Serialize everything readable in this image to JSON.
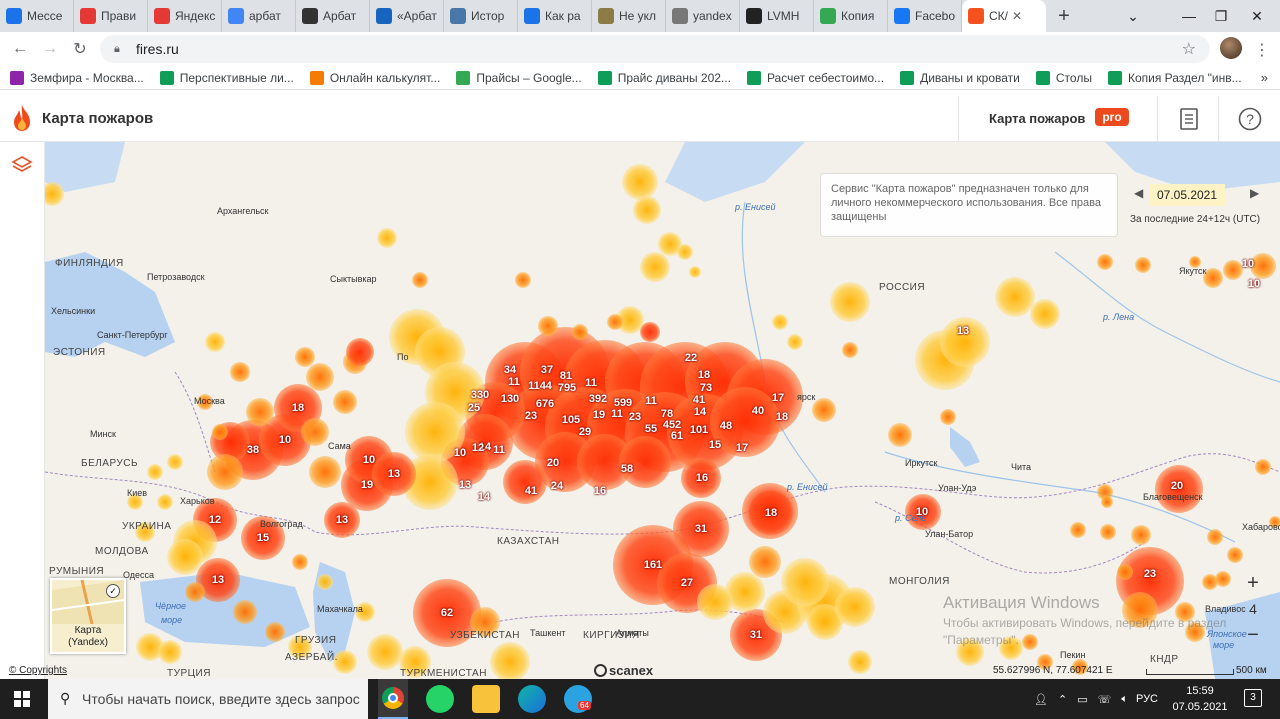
{
  "browser": {
    "tabs": [
      {
        "label": "Мессе",
        "icon": "messenger-icon",
        "color": "#1a73e8"
      },
      {
        "label": "Прави",
        "icon": "a-letter-icon",
        "color": "#e53935"
      },
      {
        "label": "Яндекс",
        "icon": "map-pin-icon",
        "color": "#e53935"
      },
      {
        "label": "арбат",
        "icon": "google-icon",
        "color": "#4285f4"
      },
      {
        "label": "Арбат",
        "icon": "wikipedia-icon",
        "color": "#333333"
      },
      {
        "label": "«Арбат",
        "icon": "news-icon",
        "color": "#1565c0"
      },
      {
        "label": "Истор",
        "icon": "vk-icon",
        "color": "#4a76a8"
      },
      {
        "label": "Как ра",
        "icon": "circle-icon",
        "color": "#1a73e8"
      },
      {
        "label": "Не укл",
        "icon": "k-letter-icon",
        "color": "#8d7b45"
      },
      {
        "label": "yandex",
        "icon": "globe-icon",
        "color": "#777777"
      },
      {
        "label": "LVMH",
        "icon": "b-letter-icon",
        "color": "#222222"
      },
      {
        "label": "Копия",
        "icon": "drive-icon",
        "color": "#34a853"
      },
      {
        "label": "Facebo",
        "icon": "facebook-icon",
        "color": "#1877f2"
      },
      {
        "label": "СК/",
        "icon": "flame-icon",
        "color": "#f4511e",
        "active": true
      }
    ],
    "url": "fires.ru",
    "bookmarks": [
      {
        "label": "Земфира - Москва...",
        "icon": "z-letter-icon",
        "color": "#8e24aa"
      },
      {
        "label": "Перспективные ли...",
        "icon": "sheets-icon",
        "color": "#0f9d58"
      },
      {
        "label": "Онлайн калькулят...",
        "icon": "p-letter-icon",
        "color": "#f57c00"
      },
      {
        "label": "Прайсы – Google...",
        "icon": "drive-icon",
        "color": "#34a853"
      },
      {
        "label": "Прайс диваны 202...",
        "icon": "sheets-icon",
        "color": "#0f9d58"
      },
      {
        "label": "Расчет себестоимо...",
        "icon": "sheets-icon",
        "color": "#0f9d58"
      },
      {
        "label": "Диваны и кровати",
        "icon": "sheets-icon",
        "color": "#0f9d58"
      },
      {
        "label": "Столы",
        "icon": "sheets-icon",
        "color": "#0f9d58"
      },
      {
        "label": "Копия Раздел \"инв...",
        "icon": "sheets-icon",
        "color": "#0f9d58"
      }
    ],
    "more_bookmarks": "»"
  },
  "app": {
    "title": "Карта пожаров",
    "pro_link": "Карта пожаров",
    "pro_badge": "pro",
    "accent": "#ec4a1c"
  },
  "info": {
    "notice": "Сервис \"Карта пожаров\" предназначен только для личного некоммерческого использования. Все права защищены",
    "date": "07.05.2021",
    "period": "За последние 24+12ч (UTC)"
  },
  "map": {
    "labels": [
      {
        "t": "Архангельск",
        "c": "city"
      },
      {
        "t": "ФИНЛЯНДИЯ",
        "c": "country"
      },
      {
        "t": "Петрозаводск",
        "c": "city"
      },
      {
        "t": "Сыктывкар",
        "c": "city"
      },
      {
        "t": "Хельсинки",
        "c": "city"
      },
      {
        "t": "ЭСТОНИЯ",
        "c": "country"
      },
      {
        "t": "Санкт-Петербург",
        "c": "city"
      },
      {
        "t": "Москва",
        "c": "city"
      },
      {
        "t": "Минск",
        "c": "city"
      },
      {
        "t": "БЕЛАРУСЬ",
        "c": "country"
      },
      {
        "t": "Киев",
        "c": "city"
      },
      {
        "t": "Харьков",
        "c": "city"
      },
      {
        "t": "УКРАИНА",
        "c": "country"
      },
      {
        "t": "Волгоград",
        "c": "city"
      },
      {
        "t": "МОЛДОВА",
        "c": "country"
      },
      {
        "t": "РУМЫНИЯ",
        "c": "country"
      },
      {
        "t": "Одесса",
        "c": "city"
      },
      {
        "t": "Чёрное",
        "c": "water"
      },
      {
        "t": "море",
        "c": "water"
      },
      {
        "t": "Махачкала",
        "c": "city"
      },
      {
        "t": "ГРУЗИЯ",
        "c": "country"
      },
      {
        "t": "АЗЕРБАЙ.",
        "c": "country"
      },
      {
        "t": "ТУРЦИЯ",
        "c": "country"
      },
      {
        "t": "ТУРКМЕНИСТАН",
        "c": "country"
      },
      {
        "t": "УЗБЕКИСТАН",
        "c": "country"
      },
      {
        "t": "Ташкент",
        "c": "city"
      },
      {
        "t": "КИРГИЗИЯ",
        "c": "country"
      },
      {
        "t": "Алматы",
        "c": "city"
      },
      {
        "t": "КАЗАХСТАН",
        "c": "country"
      },
      {
        "t": "Сама",
        "c": "city"
      },
      {
        "t": "РОССИЯ",
        "c": "country"
      },
      {
        "t": "р. Енисей",
        "c": "water"
      },
      {
        "t": "р. Лена",
        "c": "water"
      },
      {
        "t": "Якутск",
        "c": "city"
      },
      {
        "t": "Иркутск",
        "c": "city"
      },
      {
        "t": "Чита",
        "c": "city"
      },
      {
        "t": "Улан-Удэ",
        "c": "city"
      },
      {
        "t": "Улан-Батор",
        "c": "city"
      },
      {
        "t": "р. Селе",
        "c": "water"
      },
      {
        "t": "МОНГОЛИЯ",
        "c": "country"
      },
      {
        "t": "Благовещенск",
        "c": "city"
      },
      {
        "t": "Хабаровск",
        "c": "city"
      },
      {
        "t": "КНДР",
        "c": "country"
      },
      {
        "t": "Японское",
        "c": "water"
      },
      {
        "t": "море",
        "c": "water"
      },
      {
        "t": "Владивос",
        "c": "city"
      },
      {
        "t": "р. Енисей",
        "c": "water"
      },
      {
        "t": "Пекин",
        "c": "city"
      },
      {
        "t": "ярск",
        "c": "city"
      },
      {
        "t": "По",
        "c": "city"
      }
    ],
    "fire_counts": [
      "34",
      "37",
      "81",
      "11",
      "1144",
      "795",
      "330",
      "11",
      "130",
      "25",
      "676",
      "23",
      "392",
      "599",
      "11",
      "105",
      "19",
      "11",
      "23",
      "29",
      "55",
      "452",
      "101",
      "61",
      "78",
      "41",
      "14",
      "15",
      "48",
      "73",
      "18",
      "22",
      "40",
      "17",
      "18",
      "17",
      "14",
      "12",
      "11",
      "10",
      "20",
      "58",
      "24",
      "41",
      "16",
      "13",
      "14",
      "13",
      "19",
      "10",
      "38",
      "10",
      "18",
      "12",
      "15",
      "13",
      "13",
      "62",
      "161",
      "27",
      "31",
      "31",
      "18",
      "16",
      "10",
      "20",
      "23",
      "13",
      "10",
      "10"
    ],
    "coords": "55.627996 N, 77.607421 E",
    "scale": "500 км",
    "copyright": "© Copyrights",
    "provider": "scanex",
    "layer": {
      "label": "Карта",
      "sub": "(Yandex)"
    }
  },
  "windows": {
    "activate_title": "Активация Windows",
    "activate_text": "Чтобы активировать Windows, перейдите в раздел \"Параметры\".",
    "search_placeholder": "Чтобы начать поиск, введите здесь запрос",
    "lang": "РУС",
    "time": "15:59",
    "date": "07.05.2021",
    "notif_count": "3",
    "telegram_badge": "64"
  },
  "colors": {
    "fire_core": "#ff2a00",
    "fire_mid": "#ff8a00",
    "fire_light": "#ffd34a",
    "map_land": "#f3f1ea",
    "map_water": "#b6d2f0"
  }
}
